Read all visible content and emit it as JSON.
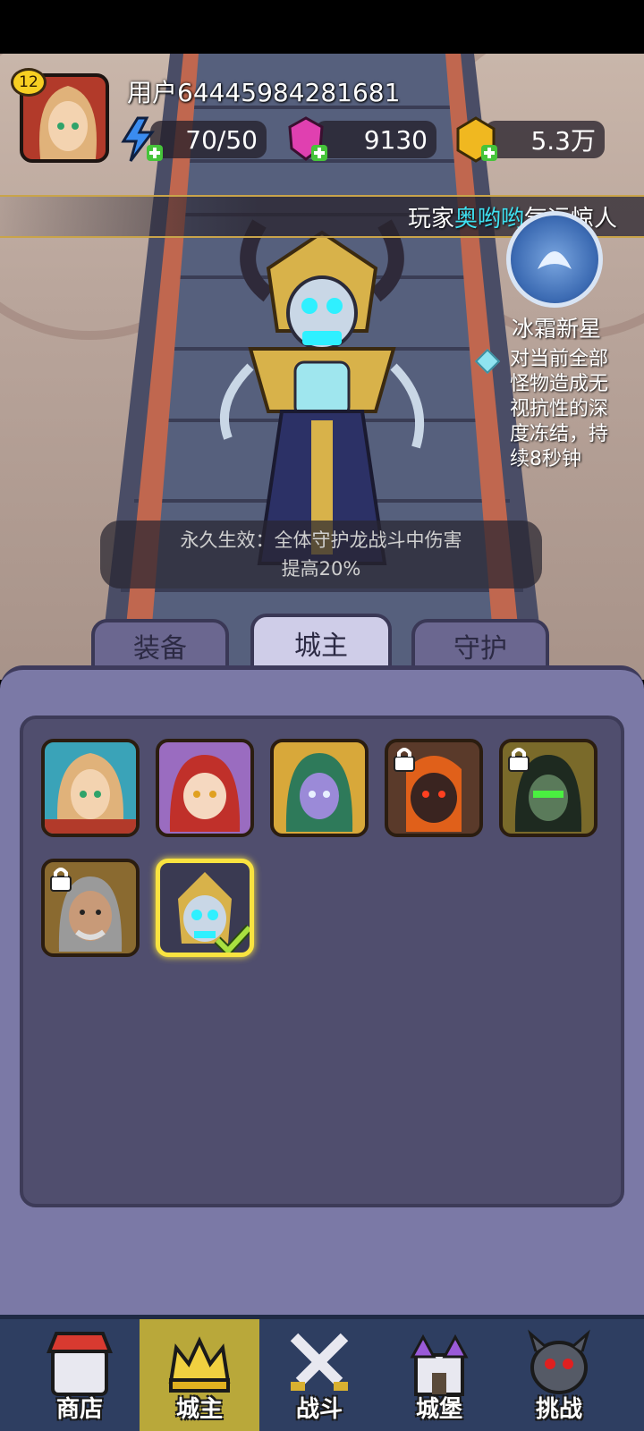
{
  "header": {
    "level": "12",
    "username": "用户64445984281681",
    "energy": "70/50",
    "gems": "9130",
    "gold": "5.3万"
  },
  "ticker": {
    "prefix": "玩家",
    "player": "奥哟哟",
    "suffix": "气运惊人"
  },
  "skill": {
    "name": "冰霜新星",
    "description": "对当前全部怪物造成无视抗性的深度冻结，持续8秒钟"
  },
  "passive": {
    "line1": "永久生效：全体守护龙战斗中伤害",
    "line2": "提高20%"
  },
  "tabs": [
    "装备",
    "城主",
    "守护"
  ],
  "nav": [
    "商店",
    "城主",
    "战斗",
    "城堡",
    "挑战"
  ],
  "colors": {
    "accent_gold": "#f9e340",
    "ticker_highlight": "#3fe0f0",
    "panel_bg": "#7b79a6",
    "nav_active": "#b9a83a"
  }
}
